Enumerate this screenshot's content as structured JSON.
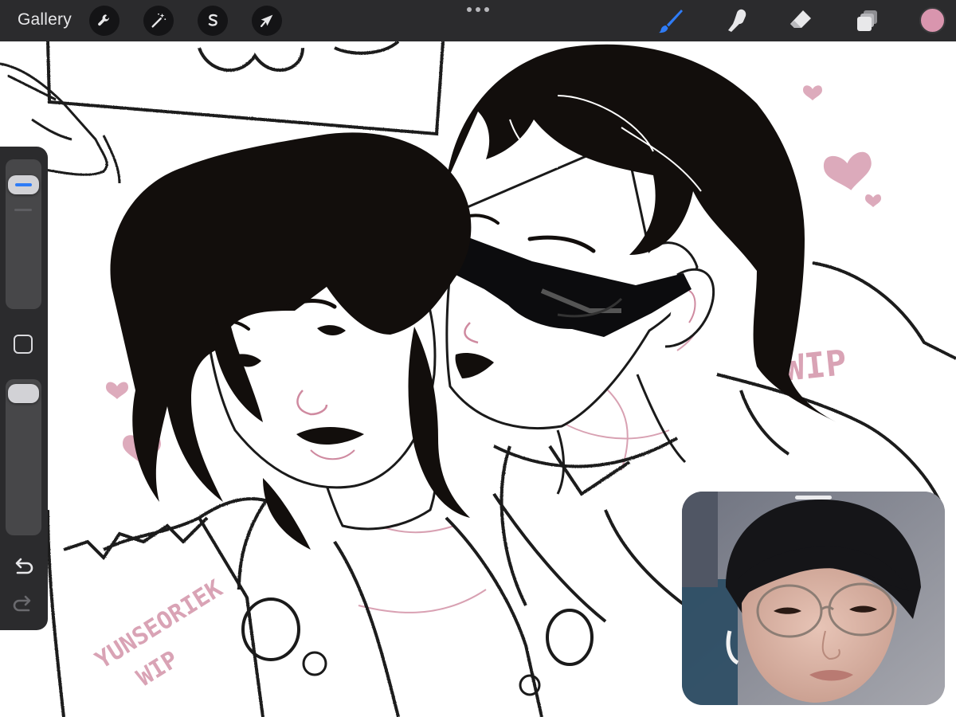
{
  "toolbar": {
    "gallery_label": "Gallery",
    "left_tools": [
      {
        "name": "actions",
        "icon": "wrench-icon"
      },
      {
        "name": "adjustments",
        "icon": "magic-wand-icon"
      },
      {
        "name": "selection",
        "icon": "selection-s-icon"
      },
      {
        "name": "transform",
        "icon": "arrow-cursor-icon"
      }
    ],
    "more_icon": "ellipsis-icon",
    "right_tools": [
      {
        "name": "brush",
        "icon": "brush-icon",
        "active": true
      },
      {
        "name": "smudge",
        "icon": "smudge-finger-icon",
        "active": false
      },
      {
        "name": "eraser",
        "icon": "eraser-icon",
        "active": false
      },
      {
        "name": "layers",
        "icon": "layers-icon",
        "active": false
      }
    ],
    "current_color": "#d995ae",
    "active_tool_color": "#2f7cf6"
  },
  "sidebar": {
    "brush_size_level": 0.08,
    "opacity_level": 0.05,
    "modify_icon": "square-icon",
    "undo_icon": "undo-arrow-icon",
    "redo_icon": "redo-arrow-icon"
  },
  "canvas": {
    "watermark_right": "WIP",
    "watermark_left_line1": "YUNSEORIEK",
    "watermark_left_line2": "WIP",
    "sketch_pink": "#cf8aa0",
    "ink_black": "#120e0c"
  },
  "pip": {
    "handle_icon": "drag-handle-icon"
  }
}
